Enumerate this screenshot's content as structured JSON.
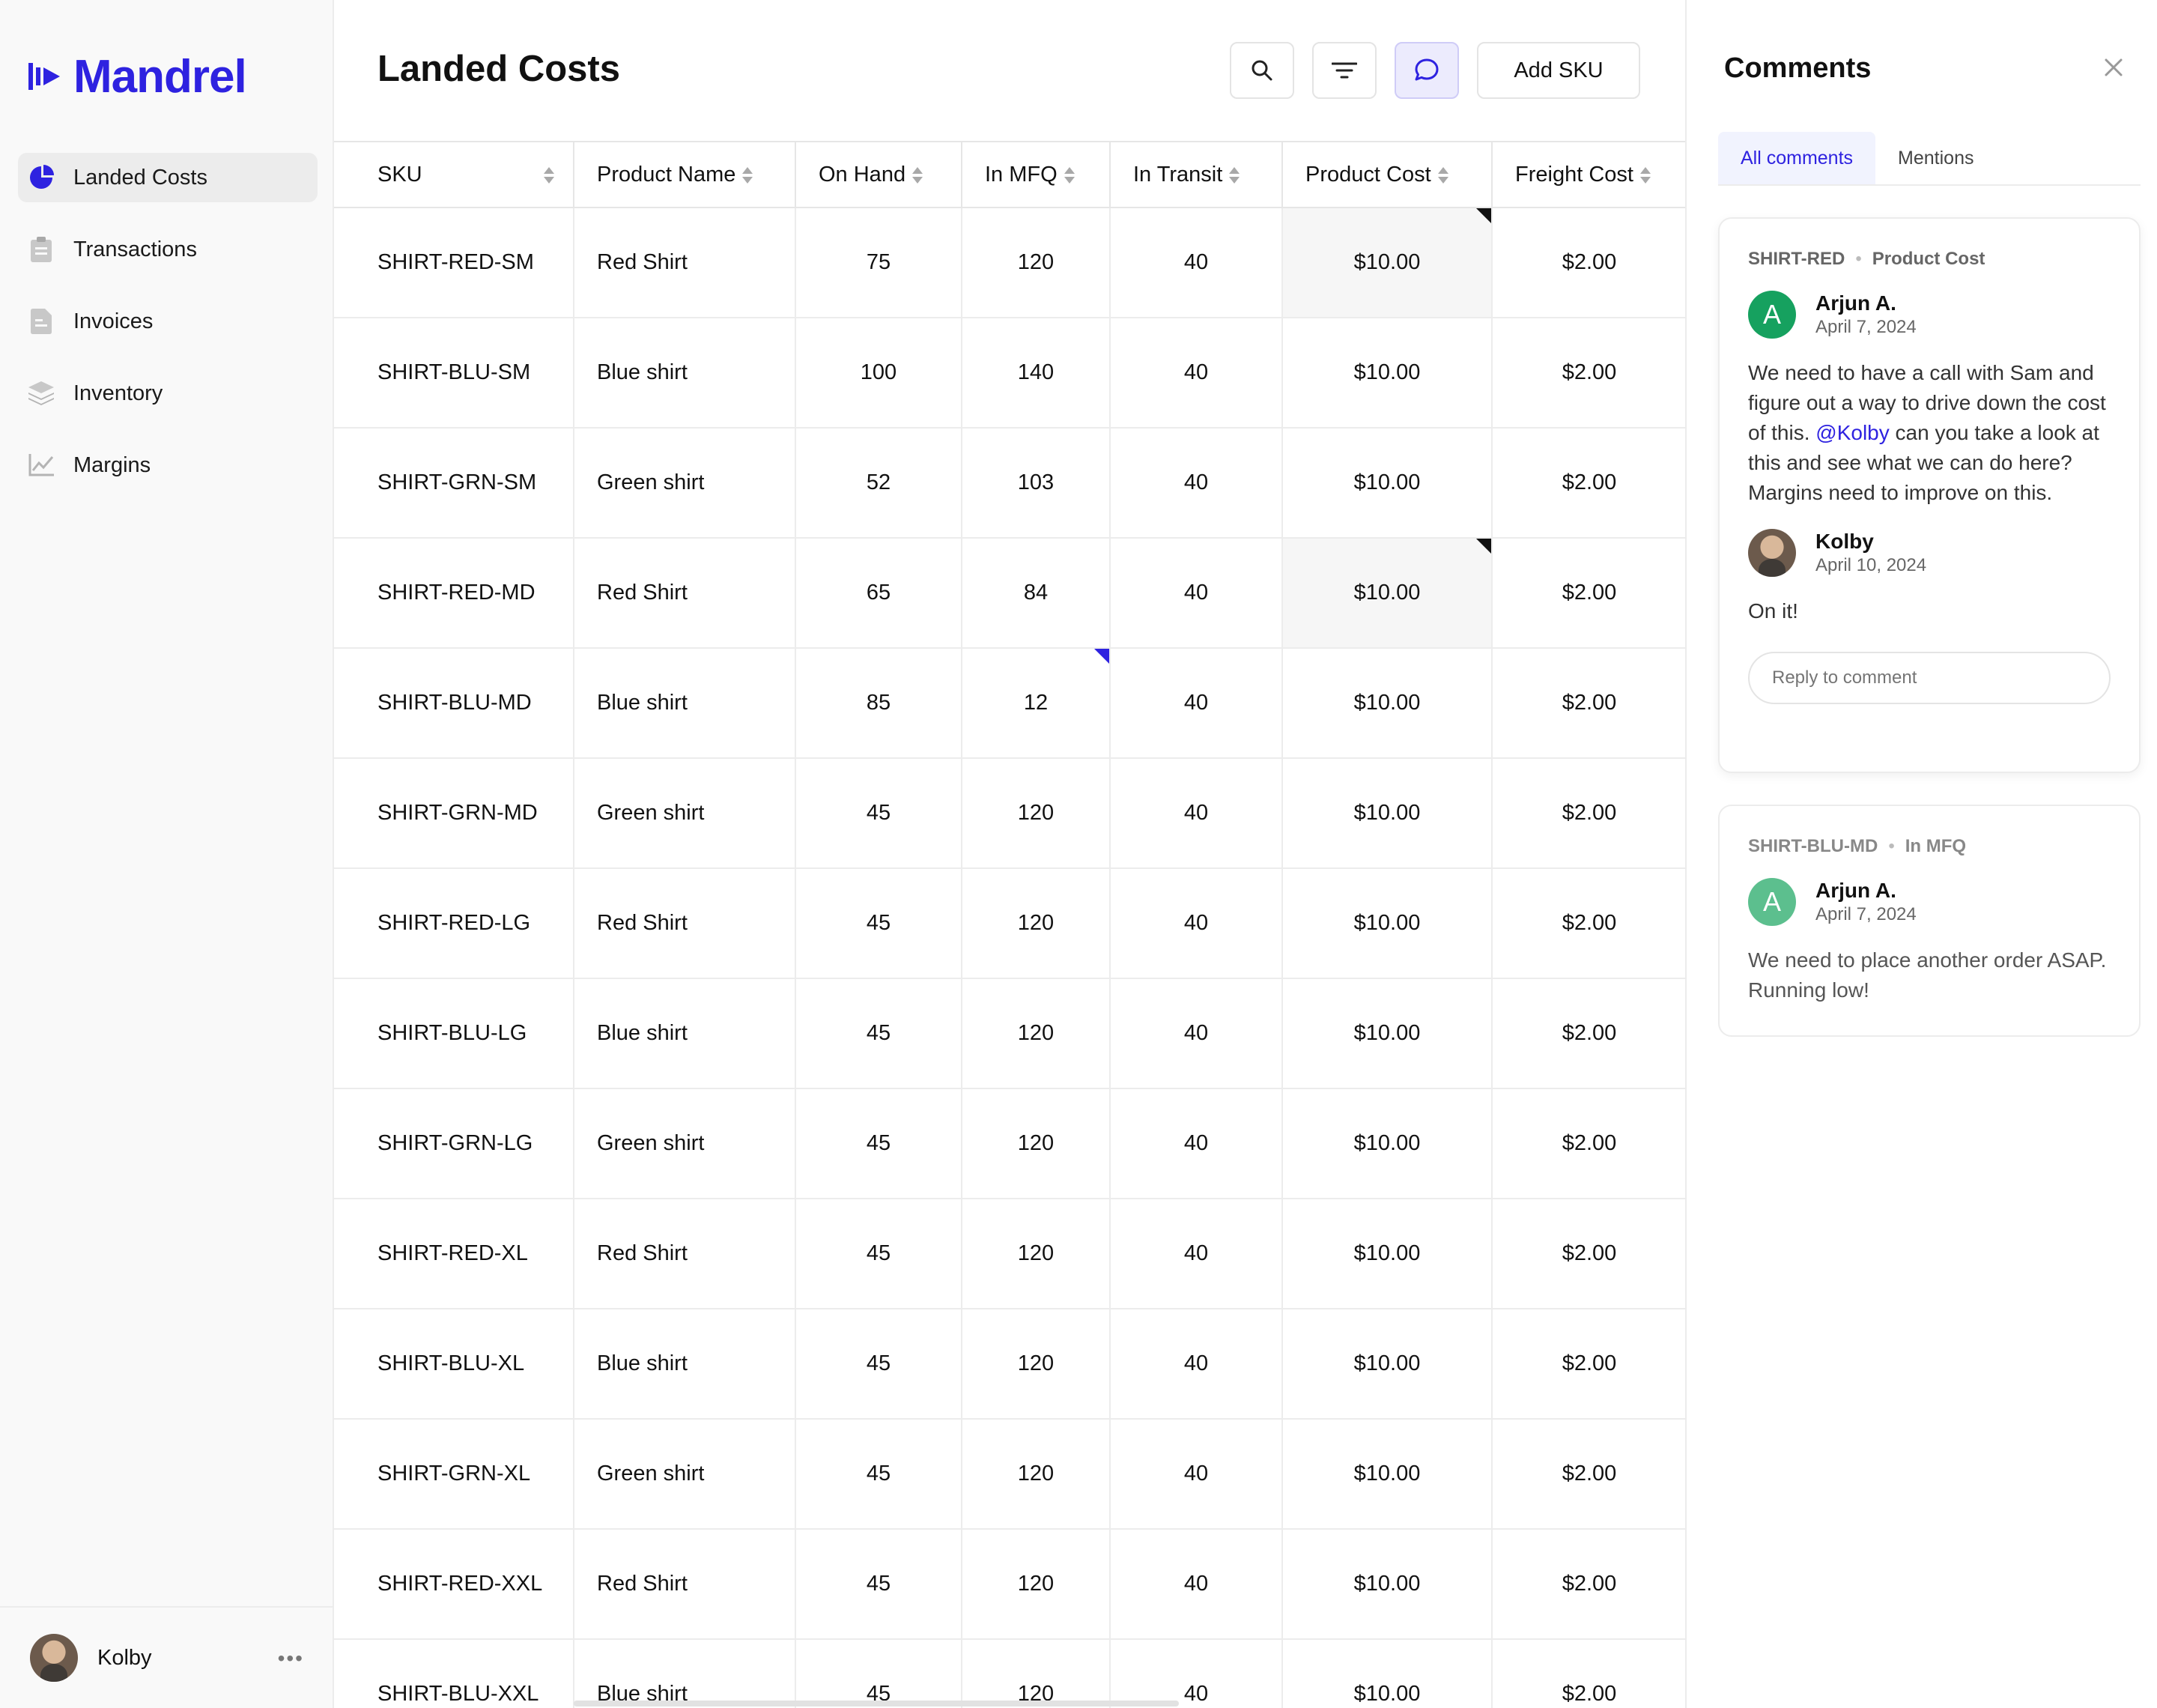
{
  "brand": {
    "name": "Mandrel",
    "color": "#2e22e0"
  },
  "sidebar": {
    "items": [
      {
        "label": "Landed Costs",
        "icon": "pie-chart-icon",
        "active": true
      },
      {
        "label": "Transactions",
        "icon": "clipboard-icon"
      },
      {
        "label": "Invoices",
        "icon": "document-icon"
      },
      {
        "label": "Inventory",
        "icon": "layers-icon"
      },
      {
        "label": "Margins",
        "icon": "line-chart-icon"
      }
    ],
    "user": {
      "name": "Kolby",
      "more": "•••"
    }
  },
  "main": {
    "title": "Landed Costs",
    "toolbar": {
      "add_label": "Add SKU",
      "icons": [
        "search-icon",
        "filter-icon",
        "comments-icon"
      ]
    }
  },
  "table": {
    "columns": [
      "SKU",
      "Product Name",
      "On Hand",
      "In MFQ",
      "In Transit",
      "Product Cost",
      "Freight Cost"
    ],
    "rows": [
      [
        "SHIRT-RED-SM",
        "Red Shirt",
        "75",
        "120",
        "40",
        "$10.00",
        "$2.00"
      ],
      [
        "SHIRT-BLU-SM",
        "Blue shirt",
        "100",
        "140",
        "40",
        "$10.00",
        "$2.00"
      ],
      [
        "SHIRT-GRN-SM",
        "Green shirt",
        "52",
        "103",
        "40",
        "$10.00",
        "$2.00"
      ],
      [
        "SHIRT-RED-MD",
        "Red Shirt",
        "65",
        "84",
        "40",
        "$10.00",
        "$2.00"
      ],
      [
        "SHIRT-BLU-MD",
        "Blue shirt",
        "85",
        "12",
        "40",
        "$10.00",
        "$2.00"
      ],
      [
        "SHIRT-GRN-MD",
        "Green shirt",
        "45",
        "120",
        "40",
        "$10.00",
        "$2.00"
      ],
      [
        "SHIRT-RED-LG",
        "Red Shirt",
        "45",
        "120",
        "40",
        "$10.00",
        "$2.00"
      ],
      [
        "SHIRT-BLU-LG",
        "Blue shirt",
        "45",
        "120",
        "40",
        "$10.00",
        "$2.00"
      ],
      [
        "SHIRT-GRN-LG",
        "Green shirt",
        "45",
        "120",
        "40",
        "$10.00",
        "$2.00"
      ],
      [
        "SHIRT-RED-XL",
        "Red Shirt",
        "45",
        "120",
        "40",
        "$10.00",
        "$2.00"
      ],
      [
        "SHIRT-BLU-XL",
        "Blue shirt",
        "45",
        "120",
        "40",
        "$10.00",
        "$2.00"
      ],
      [
        "SHIRT-GRN-XL",
        "Green shirt",
        "45",
        "120",
        "40",
        "$10.00",
        "$2.00"
      ],
      [
        "SHIRT-RED-XXL",
        "Red Shirt",
        "45",
        "120",
        "40",
        "$10.00",
        "$2.00"
      ],
      [
        "SHIRT-BLU-XXL",
        "Blue shirt",
        "45",
        "120",
        "40",
        "$10.00",
        "$2.00"
      ]
    ]
  },
  "comments": {
    "title": "Comments",
    "tabs": [
      "All comments",
      "Mentions"
    ],
    "threads": [
      {
        "sku": "SHIRT-RED",
        "field": "Product Cost",
        "entries": [
          {
            "author": "Arjun A.",
            "initial": "A",
            "date": "April 7, 2024",
            "text_before": "We need to have a call with Sam and figure out a way to drive down the cost of this. ",
            "mention": "@Kolby",
            "text_after": " can you take a look at this and see what we can do here? Margins need to improve on this."
          },
          {
            "author": "Kolby",
            "date": "April 10, 2024",
            "text": "On it!"
          }
        ],
        "reply_placeholder": "Reply to comment"
      },
      {
        "sku": "SHIRT-BLU-MD",
        "field": "In MFQ",
        "entries": [
          {
            "author": "Arjun A.",
            "initial": "A",
            "date": "April 7, 2024",
            "text": "We need to place another order ASAP. Running low!"
          }
        ]
      }
    ]
  }
}
